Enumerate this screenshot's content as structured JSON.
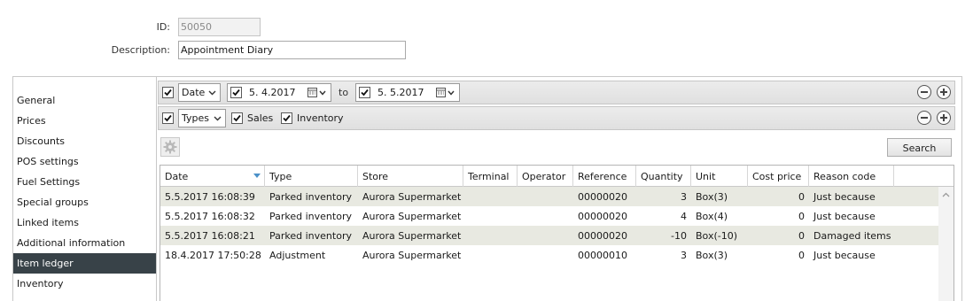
{
  "form": {
    "id_label": "ID:",
    "id_value": "50050",
    "description_label": "Description:",
    "description_value": "Appointment Diary"
  },
  "sidebar": {
    "items": [
      {
        "label": "General",
        "active": false
      },
      {
        "label": "Prices",
        "active": false
      },
      {
        "label": "Discounts",
        "active": false
      },
      {
        "label": "POS settings",
        "active": false
      },
      {
        "label": "Fuel Settings",
        "active": false
      },
      {
        "label": "Special groups",
        "active": false
      },
      {
        "label": "Linked items",
        "active": false
      },
      {
        "label": "Additional information",
        "active": false
      },
      {
        "label": "Item ledger",
        "active": true
      },
      {
        "label": "Inventory",
        "active": false
      }
    ]
  },
  "filters": {
    "date_row": {
      "enabled": true,
      "field": "Date",
      "from_checked": true,
      "from_value": "5.  4.2017",
      "to_label": "to",
      "to_checked": true,
      "to_value": "5.  5.2017"
    },
    "types_row": {
      "enabled": true,
      "field": "Types",
      "sales_label": "Sales",
      "sales_checked": true,
      "inventory_label": "Inventory",
      "inventory_checked": true
    }
  },
  "toolbar": {
    "settings_icon": "gear-icon",
    "search_label": "Search"
  },
  "table": {
    "columns": [
      "Date",
      "Type",
      "Store",
      "Terminal",
      "Operator",
      "Reference",
      "Quantity",
      "Unit",
      "Cost price",
      "Reason code"
    ],
    "sorted_column": "Date",
    "rows": [
      {
        "date": "5.5.2017 16:08:39",
        "type": "Parked inventory",
        "store": "Aurora Supermarket",
        "terminal": "",
        "operator": "",
        "reference": "00000020",
        "quantity": "3",
        "unit": "Box(3)",
        "cost_price": "0",
        "reason": "Just because"
      },
      {
        "date": "5.5.2017 16:08:32",
        "type": "Parked inventory",
        "store": "Aurora Supermarket",
        "terminal": "",
        "operator": "",
        "reference": "00000020",
        "quantity": "4",
        "unit": "Box(4)",
        "cost_price": "0",
        "reason": "Just because"
      },
      {
        "date": "5.5.2017 16:08:21",
        "type": "Parked inventory",
        "store": "Aurora Supermarket",
        "terminal": "",
        "operator": "",
        "reference": "00000020",
        "quantity": "-10",
        "unit": "Box(-10)",
        "cost_price": "0",
        "reason": "Damaged items"
      },
      {
        "date": "18.4.2017 17:50:28",
        "type": "Adjustment",
        "store": "Aurora Supermarket",
        "terminal": "",
        "operator": "",
        "reference": "00000010",
        "quantity": "3",
        "unit": "Box(3)",
        "cost_price": "0",
        "reason": "Just because"
      }
    ]
  },
  "colors": {
    "active_sidebar_bg": "#384248",
    "alt_row_bg": "#e8e9e1"
  }
}
